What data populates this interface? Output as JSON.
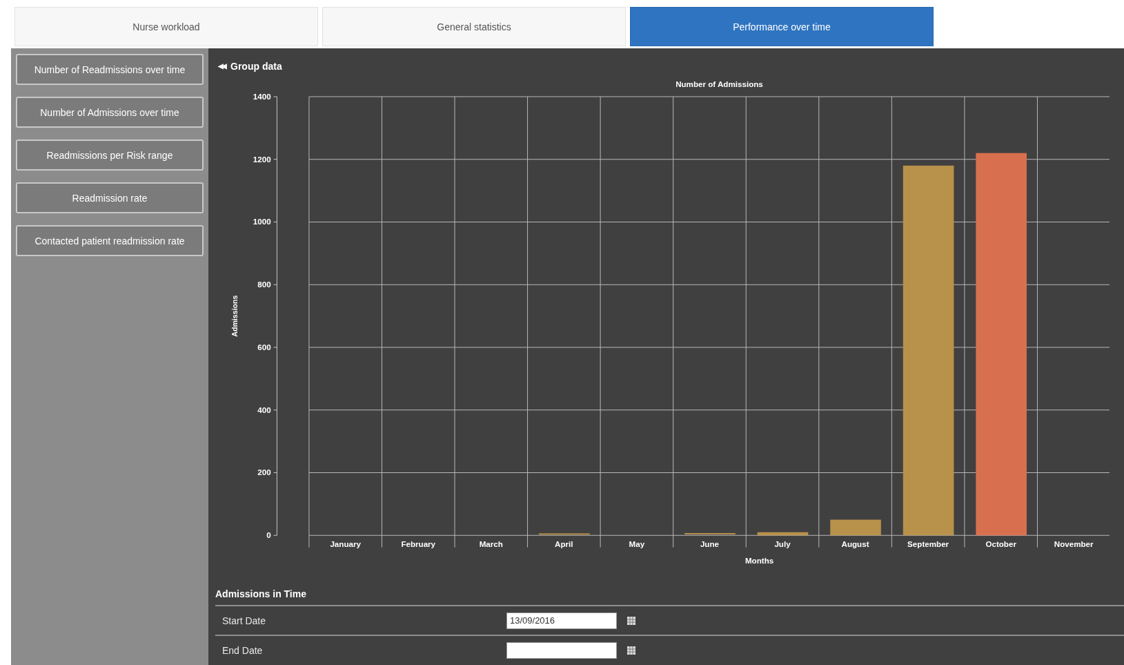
{
  "tabs": [
    {
      "label": "Nurse workload",
      "selected": false
    },
    {
      "label": "General statistics",
      "selected": false
    },
    {
      "label": "Performance over time",
      "selected": true
    }
  ],
  "sidebar": {
    "items": [
      {
        "label": "Number of Readmissions over time"
      },
      {
        "label": "Number of Admissions over time"
      },
      {
        "label": "Readmissions per Risk range"
      },
      {
        "label": "Readmission rate"
      },
      {
        "label": "Contacted patient readmission rate"
      }
    ]
  },
  "group_toggle": {
    "icon": "◀◀",
    "label": "Group data"
  },
  "chart": {
    "chart_data": {
      "type": "bar",
      "title": "Number of Admissions",
      "xlabel": "Months",
      "ylabel": "Admissions",
      "categories": [
        "January",
        "February",
        "March",
        "April",
        "May",
        "June",
        "July",
        "August",
        "September",
        "October",
        "November"
      ],
      "series": [
        {
          "color": "#b8914a",
          "values": [
            0,
            0,
            0,
            2,
            0,
            3,
            10,
            50,
            1180,
            null,
            0
          ]
        },
        {
          "color": "#d8704f",
          "values": [
            null,
            null,
            null,
            null,
            null,
            null,
            null,
            null,
            null,
            1220,
            null
          ]
        }
      ],
      "grid": true,
      "ylim": [
        0,
        1400
      ],
      "yticks": [
        0,
        200,
        400,
        600,
        800,
        1000,
        1200,
        1400
      ]
    }
  },
  "form": {
    "title": "Admissions in Time",
    "rows": [
      {
        "label": "Start Date",
        "value": "13/09/2016"
      },
      {
        "label": "End Date"
      }
    ]
  }
}
